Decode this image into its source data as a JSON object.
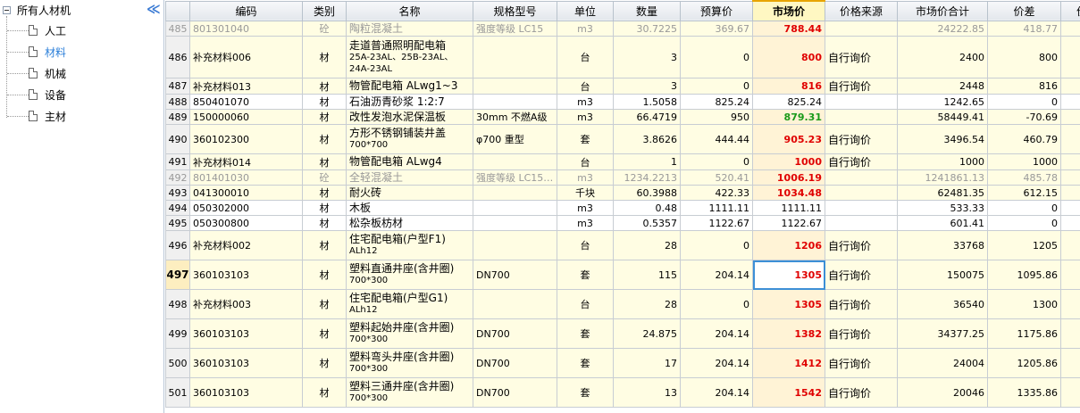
{
  "tree": {
    "root_label": "所有人材机",
    "collapse_glyph": "≪",
    "items": [
      {
        "label": "人工",
        "selected": false
      },
      {
        "label": "材料",
        "selected": true
      },
      {
        "label": "机械",
        "selected": false
      },
      {
        "label": "设备",
        "selected": false
      },
      {
        "label": "主材",
        "selected": false
      }
    ]
  },
  "grid": {
    "headers": [
      "",
      "编码",
      "类别",
      "名称",
      "规格型号",
      "单位",
      "数量",
      "预算价",
      "市场价",
      "价格来源",
      "市场价合计",
      "价差",
      "价"
    ],
    "highlight_header_index": 8,
    "rows": [
      {
        "no": "485",
        "code": "801301040",
        "cat": "砼",
        "name": "陶粒混凝土",
        "name2": "",
        "spec": "强度等级 LC15",
        "unit": "m3",
        "qty": "30.7225",
        "budget": "369.67",
        "market": "788.44",
        "source": "",
        "total": "24222.85",
        "diff": "418.77",
        "style": "gray",
        "mcolor": "red"
      },
      {
        "no": "486",
        "code": "补充材料006",
        "cat": "材",
        "name": "走道普通照明配电箱",
        "name2": "25A-23AL、25B-23AL、24A-23AL",
        "spec": "",
        "unit": "台",
        "qty": "3",
        "budget": "0",
        "market": "800",
        "source": "自行询价",
        "total": "2400",
        "diff": "800",
        "style": "",
        "mcolor": "red"
      },
      {
        "no": "487",
        "code": "补充材料013",
        "cat": "材",
        "name": "物管配电箱  ALwg1~3",
        "name2": "",
        "spec": "",
        "unit": "台",
        "qty": "3",
        "budget": "0",
        "market": "816",
        "source": "自行询价",
        "total": "2448",
        "diff": "816",
        "style": "",
        "mcolor": "red"
      },
      {
        "no": "488",
        "code": "850401070",
        "cat": "材",
        "name": "石油沥青砂浆 1:2:7",
        "name2": "",
        "spec": "",
        "unit": "m3",
        "qty": "1.5058",
        "budget": "825.24",
        "market": "825.24",
        "source": "",
        "total": "1242.65",
        "diff": "0",
        "style": "white",
        "mcolor": "plain"
      },
      {
        "no": "489",
        "code": "150000060",
        "cat": "材",
        "name": "改性发泡水泥保温板",
        "name2": "",
        "spec": "30mm 不燃A级",
        "unit": "m3",
        "qty": "66.4719",
        "budget": "950",
        "market": "879.31",
        "source": "",
        "total": "58449.41",
        "diff": "-70.69",
        "style": "",
        "mcolor": "green"
      },
      {
        "no": "490",
        "code": "360102300",
        "cat": "材",
        "name": "方形不锈钢铺装井盖",
        "name2": "700*700",
        "spec": "φ700 重型",
        "unit": "套",
        "qty": "3.8626",
        "budget": "444.44",
        "market": "905.23",
        "source": "自行询价",
        "total": "3496.54",
        "diff": "460.79",
        "style": "",
        "mcolor": "red"
      },
      {
        "no": "491",
        "code": "补充材料014",
        "cat": "材",
        "name": "物管配电箱  ALwg4",
        "name2": "",
        "spec": "",
        "unit": "台",
        "qty": "1",
        "budget": "0",
        "market": "1000",
        "source": "自行询价",
        "total": "1000",
        "diff": "1000",
        "style": "",
        "mcolor": "red"
      },
      {
        "no": "492",
        "code": "801401030",
        "cat": "砼",
        "name": "全轻混凝土",
        "name2": "",
        "spec": "强度等级 LC15…",
        "unit": "m3",
        "qty": "1234.2213",
        "budget": "520.41",
        "market": "1006.19",
        "source": "",
        "total": "1241861.13",
        "diff": "485.78",
        "style": "gray",
        "mcolor": "red"
      },
      {
        "no": "493",
        "code": "041300010",
        "cat": "材",
        "name": "耐火砖",
        "name2": "",
        "spec": "",
        "unit": "千块",
        "qty": "60.3988",
        "budget": "422.33",
        "market": "1034.48",
        "source": "",
        "total": "62481.35",
        "diff": "612.15",
        "style": "",
        "mcolor": "red"
      },
      {
        "no": "494",
        "code": "050302000",
        "cat": "材",
        "name": "木板",
        "name2": "",
        "spec": "",
        "unit": "m3",
        "qty": "0.48",
        "budget": "1111.11",
        "market": "1111.11",
        "source": "",
        "total": "533.33",
        "diff": "0",
        "style": "white",
        "mcolor": "plain"
      },
      {
        "no": "495",
        "code": "050300800",
        "cat": "材",
        "name": "松杂板枋材",
        "name2": "",
        "spec": "",
        "unit": "m3",
        "qty": "0.5357",
        "budget": "1122.67",
        "market": "1122.67",
        "source": "",
        "total": "601.41",
        "diff": "0",
        "style": "white",
        "mcolor": "plain"
      },
      {
        "no": "496",
        "code": "补充材料002",
        "cat": "材",
        "name": "住宅配电箱(户型F1)",
        "name2": "ALh12",
        "spec": "",
        "unit": "台",
        "qty": "28",
        "budget": "0",
        "market": "1206",
        "source": "自行询价",
        "total": "33768",
        "diff": "1205",
        "style": "",
        "mcolor": "red"
      },
      {
        "no": "497",
        "code": "360103103",
        "cat": "材",
        "name": "塑料直通井座(含井圈)",
        "name2": "700*300",
        "spec": "DN700",
        "unit": "套",
        "qty": "115",
        "budget": "204.14",
        "market": "1305",
        "source": "自行询价",
        "total": "150075",
        "diff": "1095.86",
        "style": "current",
        "mcolor": "red"
      },
      {
        "no": "498",
        "code": "补充材料003",
        "cat": "材",
        "name": "住宅配电箱(户型G1)",
        "name2": "ALh12",
        "spec": "",
        "unit": "台",
        "qty": "28",
        "budget": "0",
        "market": "1305",
        "source": "自行询价",
        "total": "36540",
        "diff": "1300",
        "style": "",
        "mcolor": "red"
      },
      {
        "no": "499",
        "code": "360103103",
        "cat": "材",
        "name": "塑料起始井座(含井圈)",
        "name2": "700*300",
        "spec": "DN700",
        "unit": "套",
        "qty": "24.875",
        "budget": "204.14",
        "market": "1382",
        "source": "自行询价",
        "total": "34377.25",
        "diff": "1175.86",
        "style": "",
        "mcolor": "red"
      },
      {
        "no": "500",
        "code": "360103103",
        "cat": "材",
        "name": "塑料弯头井座(含井圈)",
        "name2": "700*300",
        "spec": "DN700",
        "unit": "套",
        "qty": "17",
        "budget": "204.14",
        "market": "1412",
        "source": "自行询价",
        "total": "24004",
        "diff": "1205.86",
        "style": "",
        "mcolor": "red"
      },
      {
        "no": "501",
        "code": "360103103",
        "cat": "材",
        "name": "塑料三通井座(含井圈)",
        "name2": "700*300",
        "spec": "DN700",
        "unit": "套",
        "qty": "13",
        "budget": "204.14",
        "market": "1542",
        "source": "自行询价",
        "total": "20046",
        "diff": "1335.86",
        "style": "",
        "mcolor": "red"
      }
    ]
  },
  "colors": {
    "accent": "#3c8fd6",
    "price_up": "#e00000",
    "price_down": "#1a9a1a",
    "row_bg": "#fffde3"
  }
}
